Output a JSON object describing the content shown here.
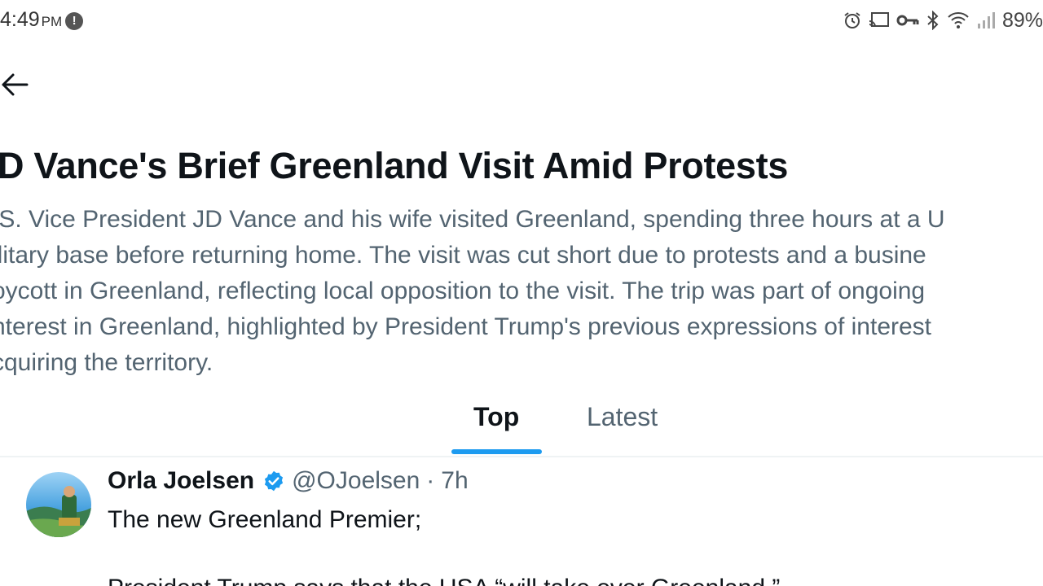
{
  "status_bar": {
    "time": "4:49",
    "ampm": "PM",
    "notification_badge": "!",
    "battery": "89%",
    "icons": [
      "alarm-icon",
      "cast-icon",
      "vpn-key-icon",
      "bluetooth-icon",
      "wifi-icon",
      "signal-icon"
    ]
  },
  "header": {
    "back_icon": "arrow-left-icon"
  },
  "topic": {
    "title": "D Vance's Brief Greenland Visit Amid Protests",
    "summary_lines": [
      ".S. Vice President JD Vance and his wife visited Greenland, spending three hours at a U",
      "ilitary base before returning home. The visit was cut short due to protests and a busine",
      "oycott in Greenland, reflecting local opposition to the visit. The trip was part of ongoing",
      "nterest in Greenland, highlighted by President Trump's previous expressions of interest",
      "cquiring the territory."
    ]
  },
  "tabs": [
    {
      "label": "Top",
      "selected": true
    },
    {
      "label": "Latest",
      "selected": false
    }
  ],
  "tweet": {
    "author_name": "Orla Joelsen",
    "author_handle": "@OJoelsen",
    "separator": "·",
    "time": "7h",
    "text_line1": "The new Greenland Premier;",
    "text_line2": "President Trump says that the USA “will take over Greenland.”"
  },
  "colors": {
    "accent": "#1d9bf0",
    "primary_text": "#0f1419",
    "secondary_text": "#536471",
    "divider": "#eff3f4"
  }
}
